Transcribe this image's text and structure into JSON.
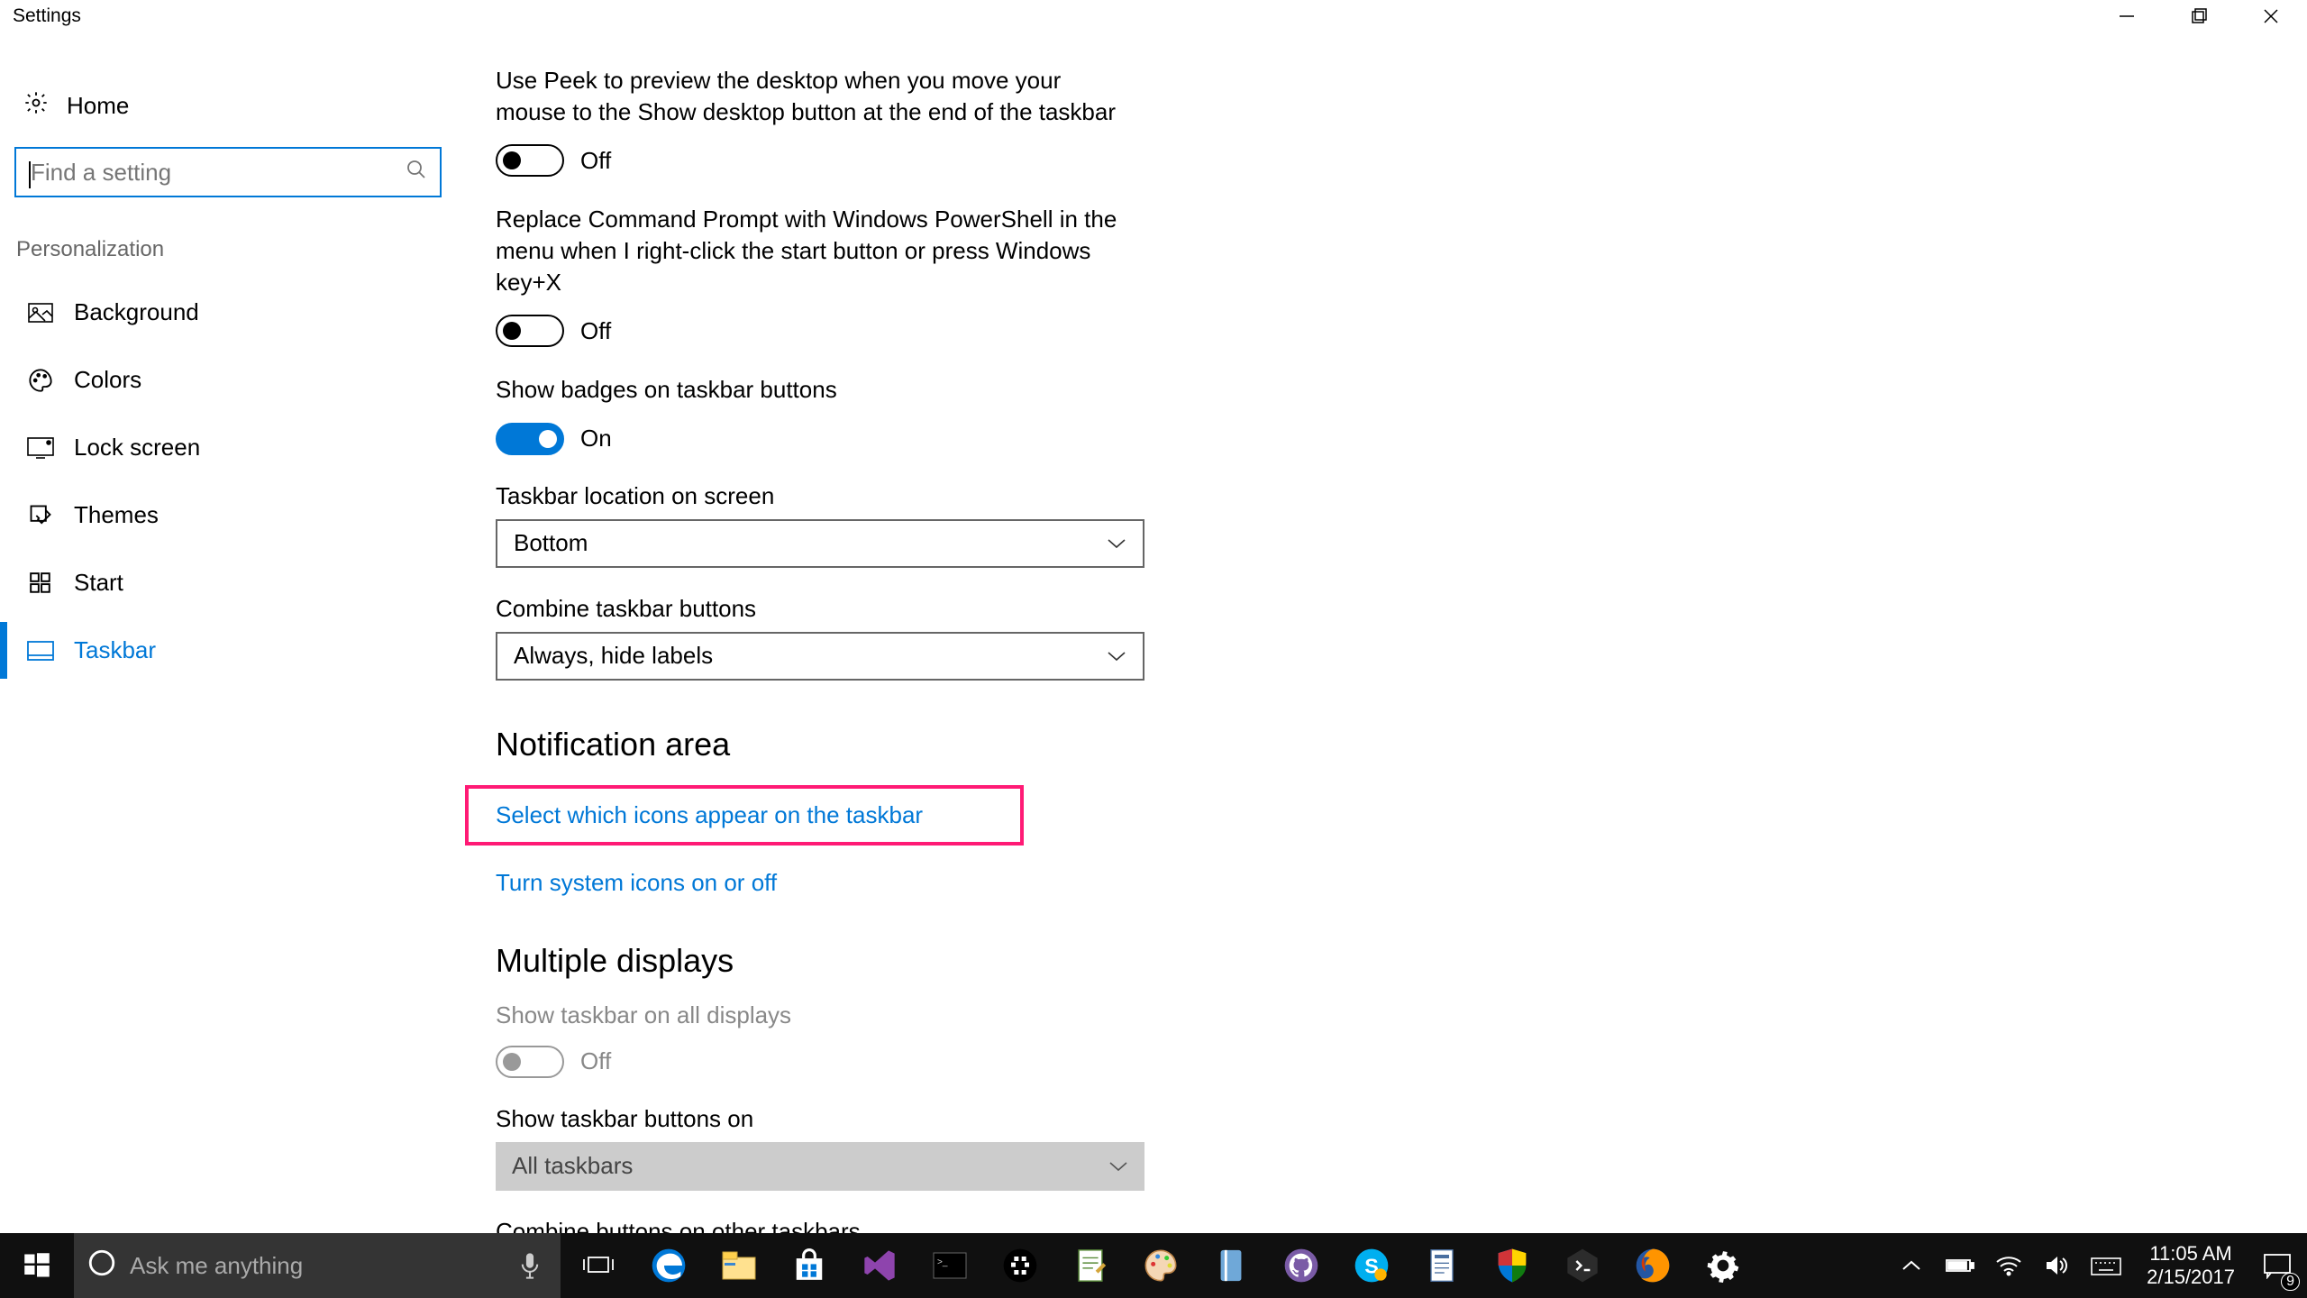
{
  "window": {
    "title": "Settings"
  },
  "sidebar": {
    "home": "Home",
    "search_placeholder": "Find a setting",
    "section": "Personalization",
    "items": [
      {
        "label": "Background"
      },
      {
        "label": "Colors"
      },
      {
        "label": "Lock screen"
      },
      {
        "label": "Themes"
      },
      {
        "label": "Start"
      },
      {
        "label": "Taskbar"
      }
    ]
  },
  "content": {
    "s0": {
      "desc": "Use Peek to preview the desktop when you move your mouse to the Show desktop button at the end of the taskbar",
      "state": "Off"
    },
    "s1": {
      "desc": "Replace Command Prompt with Windows PowerShell in the menu when I right-click the start button or press Windows key+X",
      "state": "Off"
    },
    "s2": {
      "desc": "Show badges on taskbar buttons",
      "state": "On"
    },
    "loc": {
      "label": "Taskbar location on screen",
      "value": "Bottom"
    },
    "combine": {
      "label": "Combine taskbar buttons",
      "value": "Always, hide labels"
    },
    "notif": {
      "heading": "Notification area",
      "link1": "Select which icons appear on the taskbar",
      "link2": "Turn system icons on or off"
    },
    "multi": {
      "heading": "Multiple displays",
      "show_all": {
        "label": "Show taskbar on all displays",
        "state": "Off"
      },
      "buttons_on": {
        "label": "Show taskbar buttons on",
        "value": "All taskbars"
      },
      "combine_other": "Combine buttons on other taskbars"
    }
  },
  "taskbar": {
    "cortana_placeholder": "Ask me anything",
    "clock": {
      "time": "11:05 AM",
      "date": "2/15/2017"
    },
    "notif_count": "9"
  }
}
